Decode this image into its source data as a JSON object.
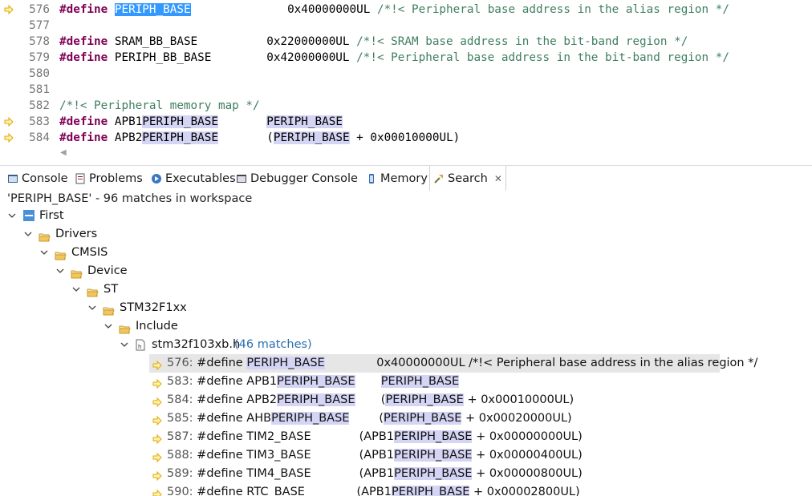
{
  "editor": {
    "lines": [
      {
        "num": "576",
        "marker": true,
        "parts": [
          [
            "kw",
            "#define"
          ],
          [
            "t",
            " "
          ],
          [
            "sel",
            "PERIPH_BASE"
          ],
          [
            "t",
            "              0x40000000UL "
          ],
          [
            "cm",
            "/*!< Peripheral base address in the alias region */"
          ]
        ]
      },
      {
        "num": "577",
        "marker": false,
        "parts": []
      },
      {
        "num": "578",
        "marker": false,
        "parts": [
          [
            "kw",
            "#define"
          ],
          [
            "t",
            " SRAM_BB_BASE          0x22000000UL "
          ],
          [
            "cm",
            "/*!< SRAM base address in the bit-band region */"
          ]
        ]
      },
      {
        "num": "579",
        "marker": false,
        "parts": [
          [
            "kw",
            "#define"
          ],
          [
            "t",
            " PERIPH_BB_BASE        0x42000000UL "
          ],
          [
            "cm",
            "/*!< Peripheral base address in the bit-band region */"
          ]
        ]
      },
      {
        "num": "580",
        "marker": false,
        "parts": []
      },
      {
        "num": "581",
        "marker": false,
        "parts": []
      },
      {
        "num": "582",
        "marker": false,
        "parts": [
          [
            "cm",
            "/*!< Peripheral memory map */"
          ]
        ]
      },
      {
        "num": "583",
        "marker": true,
        "parts": [
          [
            "kw",
            "#define"
          ],
          [
            "t",
            " APB1"
          ],
          [
            "hl",
            "PERIPH_BASE"
          ],
          [
            "t",
            "       "
          ],
          [
            "hl",
            "PERIPH_BASE"
          ]
        ]
      },
      {
        "num": "584",
        "marker": true,
        "parts": [
          [
            "kw",
            "#define"
          ],
          [
            "t",
            " APB2"
          ],
          [
            "hl",
            "PERIPH_BASE"
          ],
          [
            "t",
            "       ("
          ],
          [
            "hl",
            "PERIPH_BASE"
          ],
          [
            "t",
            " + 0x00010000UL)"
          ]
        ]
      }
    ]
  },
  "tabs": [
    {
      "label": "Console",
      "icon": "console-icon"
    },
    {
      "label": "Problems",
      "icon": "problems-icon"
    },
    {
      "label": "Executables",
      "icon": "executables-icon"
    },
    {
      "label": "Debugger Console",
      "icon": "debugger-console-icon"
    },
    {
      "label": "Memory",
      "icon": "memory-icon"
    },
    {
      "label": "Search",
      "icon": "search-icon",
      "active": true
    }
  ],
  "search": {
    "summary": "'PERIPH_BASE' - 96 matches in workspace",
    "tree": [
      {
        "label": "First",
        "kind": "project"
      },
      {
        "label": "Drivers",
        "kind": "folder"
      },
      {
        "label": "CMSIS",
        "kind": "folder"
      },
      {
        "label": "Device",
        "kind": "folder"
      },
      {
        "label": "ST",
        "kind": "folder"
      },
      {
        "label": "STM32F1xx",
        "kind": "folder"
      },
      {
        "label": "Include",
        "kind": "folder"
      },
      {
        "label": "stm32f103xb.h",
        "kind": "file",
        "count": "(46 matches)"
      }
    ],
    "results": [
      {
        "parts": [
          [
            "ln2",
            "576: "
          ],
          [
            "t",
            "#define "
          ],
          [
            "hl",
            "PERIPH_BASE"
          ],
          [
            "t",
            "              0x40000000UL /*!< Peripheral base address in the alias region */"
          ]
        ],
        "selected": true
      },
      {
        "parts": [
          [
            "ln2",
            "583: "
          ],
          [
            "t",
            "#define APB1"
          ],
          [
            "hl",
            "PERIPH_BASE"
          ],
          [
            "t",
            "       "
          ],
          [
            "hl",
            "PERIPH_BASE"
          ]
        ]
      },
      {
        "parts": [
          [
            "ln2",
            "584: "
          ],
          [
            "t",
            "#define APB2"
          ],
          [
            "hl",
            "PERIPH_BASE"
          ],
          [
            "t",
            "       ("
          ],
          [
            "hl",
            "PERIPH_BASE"
          ],
          [
            "t",
            " + 0x00010000UL)"
          ]
        ]
      },
      {
        "parts": [
          [
            "ln2",
            "585: "
          ],
          [
            "t",
            "#define AHB"
          ],
          [
            "hl",
            "PERIPH_BASE"
          ],
          [
            "t",
            "        ("
          ],
          [
            "hl",
            "PERIPH_BASE"
          ],
          [
            "t",
            " + 0x00020000UL)"
          ]
        ]
      },
      {
        "parts": [
          [
            "ln2",
            "587: "
          ],
          [
            "t",
            "#define TIM2_BASE             (APB1"
          ],
          [
            "hl",
            "PERIPH_BASE"
          ],
          [
            "t",
            " + 0x00000000UL)"
          ]
        ]
      },
      {
        "parts": [
          [
            "ln2",
            "588: "
          ],
          [
            "t",
            "#define TIM3_BASE             (APB1"
          ],
          [
            "hl",
            "PERIPH_BASE"
          ],
          [
            "t",
            " + 0x00000400UL)"
          ]
        ]
      },
      {
        "parts": [
          [
            "ln2",
            "589: "
          ],
          [
            "t",
            "#define TIM4_BASE             (APB1"
          ],
          [
            "hl",
            "PERIPH_BASE"
          ],
          [
            "t",
            " + 0x00000800UL)"
          ]
        ]
      },
      {
        "parts": [
          [
            "ln2",
            "590: "
          ],
          [
            "t",
            "#define RTC_BASE              (APB1"
          ],
          [
            "hl",
            "PERIPH_BASE"
          ],
          [
            "t",
            " + 0x00002800UL)"
          ]
        ]
      }
    ]
  },
  "colors": {
    "keyword": "#7f0055",
    "comment": "#3f7f5f",
    "match_highlight": "#d4d4f4",
    "selection": "#3399ff",
    "marker_arrow": "#e0a800",
    "folder": "#e8b64a"
  }
}
